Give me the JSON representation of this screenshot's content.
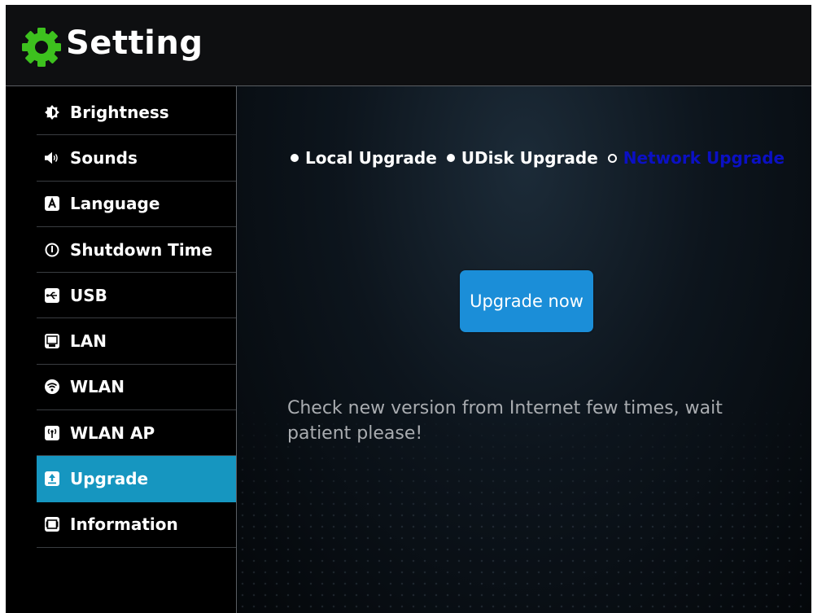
{
  "header": {
    "title": "Setting",
    "icon": "gear-icon",
    "icon_color": "#3dc11e"
  },
  "sidebar": {
    "items": [
      {
        "label": "Brightness",
        "icon": "brightness-icon"
      },
      {
        "label": "Sounds",
        "icon": "speaker-icon"
      },
      {
        "label": "Language",
        "icon": "language-icon"
      },
      {
        "label": "Shutdown Time",
        "icon": "power-icon"
      },
      {
        "label": "USB",
        "icon": "usb-icon"
      },
      {
        "label": "LAN",
        "icon": "lan-icon"
      },
      {
        "label": "WLAN",
        "icon": "wifi-icon"
      },
      {
        "label": "WLAN AP",
        "icon": "hotspot-icon"
      },
      {
        "label": "Upgrade",
        "icon": "upgrade-icon",
        "active": true
      },
      {
        "label": "Information",
        "icon": "information-icon"
      }
    ],
    "active_color": "#1696c0"
  },
  "content": {
    "tabs": [
      {
        "label": "Local Upgrade",
        "selected": false
      },
      {
        "label": "UDisk Upgrade",
        "selected": false
      },
      {
        "label": "Network Upgrade",
        "selected": true
      }
    ],
    "selected_tab_color": "#0b10c4",
    "upgrade_button": "Upgrade now",
    "button_color": "#1b8ed8",
    "message": "Check new version from Internet few times, wait patient please!"
  }
}
